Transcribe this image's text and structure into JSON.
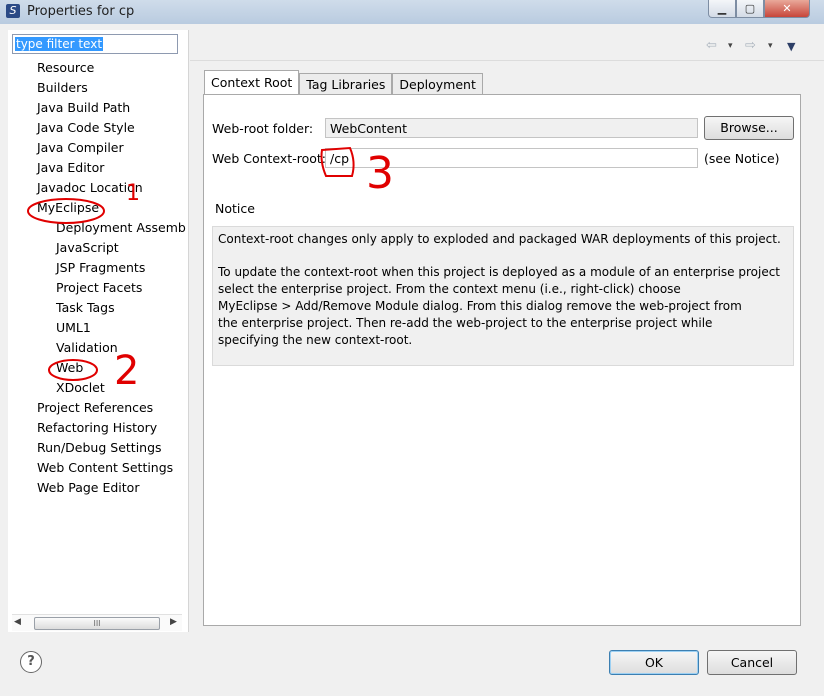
{
  "window": {
    "title": "Properties for cp",
    "app_icon": "S",
    "controls": {
      "minimize": "▁",
      "maximize": "▢",
      "close": "✕"
    }
  },
  "filter": {
    "value": "type filter text"
  },
  "tree": [
    {
      "label": "Resource",
      "level": 0
    },
    {
      "label": "Builders",
      "level": 0
    },
    {
      "label": "Java Build Path",
      "level": 0
    },
    {
      "label": "Java Code Style",
      "level": 0
    },
    {
      "label": "Java Compiler",
      "level": 0
    },
    {
      "label": "Java Editor",
      "level": 0
    },
    {
      "label": "Javadoc Location",
      "level": 0
    },
    {
      "label": "MyEclipse",
      "level": 0
    },
    {
      "label": "Deployment Assembly",
      "level": 1
    },
    {
      "label": "JavaScript",
      "level": 1
    },
    {
      "label": "JSP Fragments",
      "level": 1
    },
    {
      "label": "Project Facets",
      "level": 1
    },
    {
      "label": "Task Tags",
      "level": 1
    },
    {
      "label": "UML1",
      "level": 1
    },
    {
      "label": "Validation",
      "level": 1
    },
    {
      "label": "Web",
      "level": 1
    },
    {
      "label": "XDoclet",
      "level": 1
    },
    {
      "label": "Project References",
      "level": 0
    },
    {
      "label": "Refactoring History",
      "level": 0
    },
    {
      "label": "Run/Debug Settings",
      "level": 0
    },
    {
      "label": "Web Content Settings",
      "level": 0
    },
    {
      "label": "Web Page Editor",
      "level": 0
    }
  ],
  "tabs": [
    "Context Root",
    "Tag Libraries",
    "Deployment"
  ],
  "form": {
    "webroot_label": "Web-root folder:",
    "webroot_value": "WebContent",
    "browse_label": "Browse...",
    "context_label": "Web Context-root:",
    "context_value": "/cp",
    "see_notice": "(see Notice)"
  },
  "notice": {
    "heading": "Notice",
    "para1": "Context-root changes only apply to exploded and packaged WAR deployments of this project.",
    "para2_lines": [
      "To update the context-root when this project is deployed as a module of an enterprise project",
      "select the enterprise project. From the context menu (i.e., right-click) choose",
      "MyEclipse > Add/Remove Module dialog. From this dialog remove the web-project from",
      "the enterprise project. Then re-add the web-project to the enterprise project while",
      "specifying the new context-root."
    ]
  },
  "buttons": {
    "ok": "OK",
    "cancel": "Cancel",
    "help": "?"
  },
  "scrollbar": {
    "thumb_grip": "III",
    "left": "◀",
    "right": "▶"
  },
  "nav": {
    "back": "⇦",
    "forward": "⇨",
    "dropdown": "▾",
    "menu": "▼"
  },
  "annotations": {
    "one": "1",
    "two": "2",
    "three": "3",
    "color": "#e00000"
  }
}
